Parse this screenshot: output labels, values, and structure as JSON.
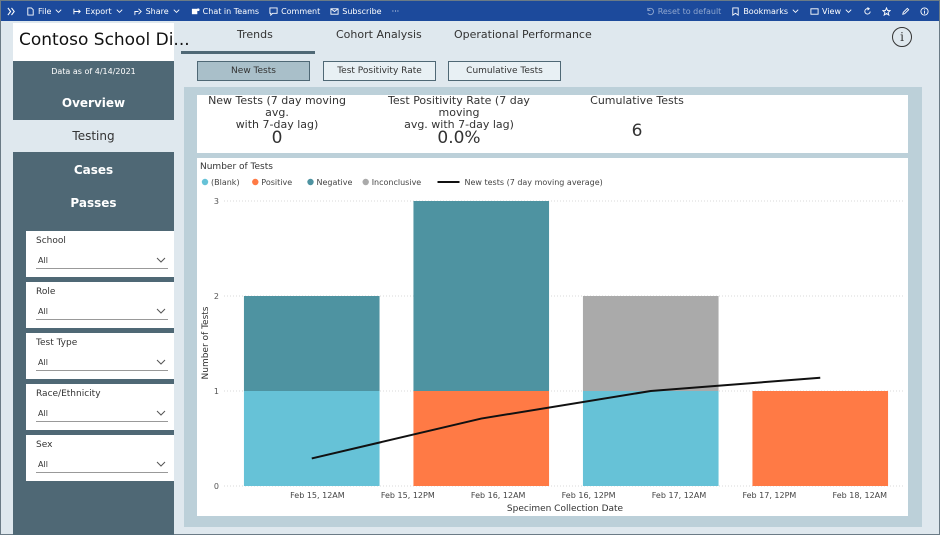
{
  "toolbar": {
    "file": "File",
    "export": "Export",
    "share": "Share",
    "chat": "Chat in Teams",
    "comment": "Comment",
    "subscribe": "Subscribe",
    "more": "···",
    "reset": "Reset to default",
    "bookmarks": "Bookmarks",
    "view": "View"
  },
  "nav": {
    "title": "Contoso School Di...",
    "data_date": "Data as of 4/14/2021",
    "items": [
      {
        "label": "Overview"
      },
      {
        "label": "Testing"
      },
      {
        "label": "Cases"
      },
      {
        "label": "Passes"
      }
    ]
  },
  "filters": [
    {
      "label": "School",
      "value": "All"
    },
    {
      "label": "Role",
      "value": "All"
    },
    {
      "label": "Test Type",
      "value": "All"
    },
    {
      "label": "Race/Ethnicity",
      "value": "All"
    },
    {
      "label": "Sex",
      "value": "All"
    }
  ],
  "tabs": [
    {
      "label": "Trends"
    },
    {
      "label": "Cohort Analysis"
    },
    {
      "label": "Operational Performance"
    }
  ],
  "info_icon": "i",
  "subtabs": [
    {
      "label": "New Tests"
    },
    {
      "label": "Test Positivity Rate"
    },
    {
      "label": "Cumulative Tests"
    }
  ],
  "kpis": [
    {
      "label_line1": "New Tests (7 day moving avg.",
      "label_line2": "with 7-day lag)",
      "value": "0"
    },
    {
      "label_line1": "Test Positivity Rate (7 day moving",
      "label_line2": "avg. with 7-day lag)",
      "value": "0.0%"
    },
    {
      "label_line1": "Cumulative Tests",
      "label_line2": "",
      "value": "6"
    }
  ],
  "colors": {
    "blank": "#66c2d7",
    "positive": "#ff7a45",
    "negative": "#4e93a1",
    "inconclusive": "#aaaaaa",
    "line": "#111111"
  },
  "chart_data": {
    "type": "bar",
    "stacked": true,
    "title": "Number of Tests",
    "xlabel": "Specimen Collection Date",
    "ylabel": "Number of Tests",
    "ylim": [
      0,
      3
    ],
    "y_ticks": [
      0,
      1,
      2,
      3
    ],
    "x_tick_labels": [
      "Feb 15, 12AM",
      "Feb 15, 12PM",
      "Feb 16, 12AM",
      "Feb 16, 12PM",
      "Feb 17, 12AM",
      "Feb 17, 12PM",
      "Feb 18, 12AM"
    ],
    "legend": [
      "(Blank)",
      "Positive",
      "Negative",
      "Inconclusive",
      "New tests (7 day moving average)"
    ],
    "legend_position": "top-left",
    "categories": [
      "Feb 15",
      "Feb 16",
      "Feb 17",
      "Feb 18"
    ],
    "series": [
      {
        "name": "(Blank)",
        "values": [
          1,
          0,
          1,
          0
        ]
      },
      {
        "name": "Positive",
        "values": [
          0,
          1,
          0,
          1
        ]
      },
      {
        "name": "Negative",
        "values": [
          1,
          2,
          0,
          0
        ]
      },
      {
        "name": "Inconclusive",
        "values": [
          0,
          0,
          1,
          0
        ]
      }
    ],
    "line": {
      "name": "New tests (7 day moving average)",
      "values": [
        0.29,
        0.71,
        1.0,
        1.14
      ]
    }
  }
}
